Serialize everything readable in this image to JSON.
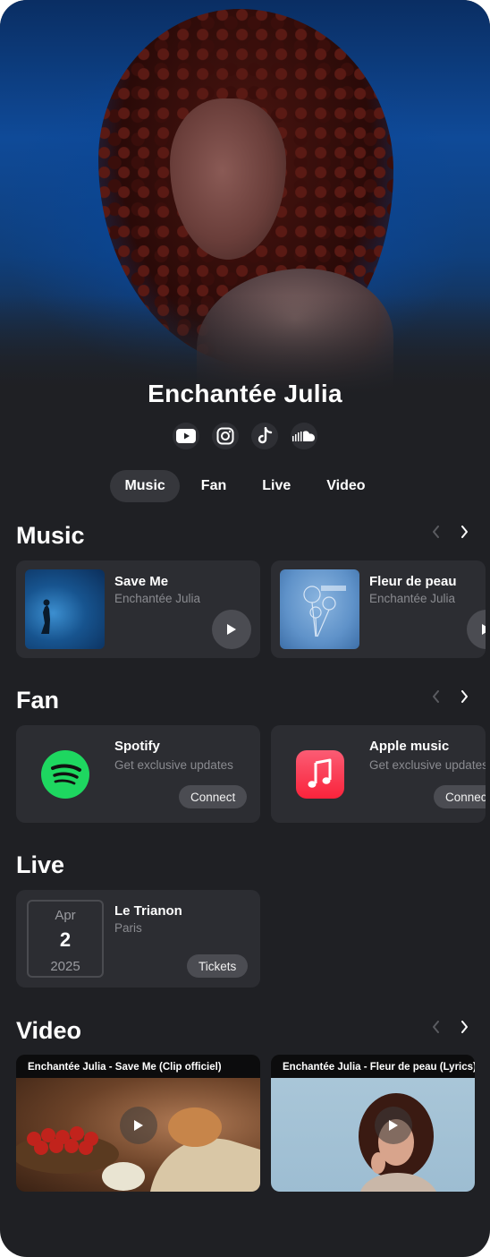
{
  "artist": {
    "name": "Enchantée Julia"
  },
  "socials": [
    {
      "name": "youtube-icon"
    },
    {
      "name": "instagram-icon"
    },
    {
      "name": "tiktok-icon"
    },
    {
      "name": "soundcloud-icon"
    }
  ],
  "tabs": [
    {
      "label": "Music",
      "active": true
    },
    {
      "label": "Fan",
      "active": false
    },
    {
      "label": "Live",
      "active": false
    },
    {
      "label": "Video",
      "active": false
    }
  ],
  "music": {
    "title": "Music",
    "items": [
      {
        "title": "Save Me",
        "artist": "Enchantée Julia"
      },
      {
        "title": "Fleur de peau",
        "artist": "Enchantée Julia"
      }
    ]
  },
  "fan": {
    "title": "Fan",
    "items": [
      {
        "title": "Spotify",
        "desc": "Get exclusive updates",
        "button": "Connect",
        "color": "#1ed760"
      },
      {
        "title": "Apple music",
        "desc": "Get exclusive updates",
        "button": "Connect",
        "color": "#fa3c52"
      }
    ]
  },
  "live": {
    "title": "Live",
    "items": [
      {
        "month": "Apr",
        "day": "2",
        "year": "2025",
        "venue": "Le Trianon",
        "city": "Paris",
        "button": "Tickets"
      }
    ]
  },
  "video": {
    "title": "Video",
    "items": [
      {
        "title": "Enchantée Julia - Save Me (Clip officiel)"
      },
      {
        "title": "Enchantée Julia - Fleur de peau (Lyrics)"
      }
    ]
  },
  "colors": {
    "background": "#1f2024",
    "card": "#2c2d32",
    "accent_tab": "#36373c"
  }
}
